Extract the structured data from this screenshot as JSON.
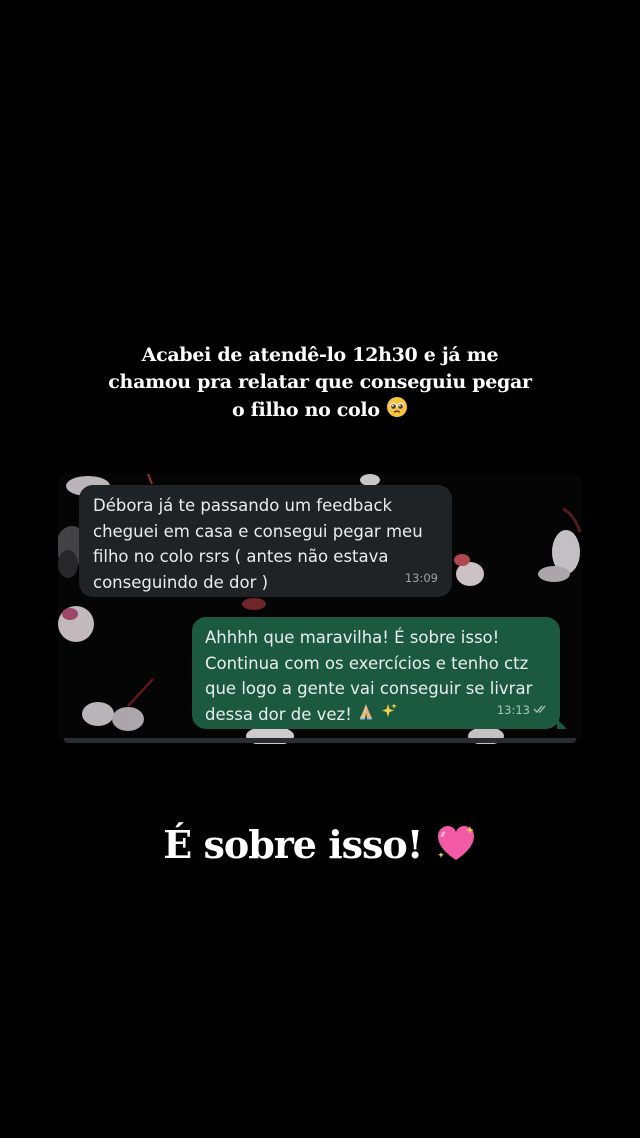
{
  "top_caption": {
    "line1": "Acabei de atendê-lo 12h30 e já me",
    "line2": "chamou pra relatar que conseguiu pegar",
    "line3": "o filho no colo",
    "emoji": "pleading-face-icon"
  },
  "chat": {
    "incoming": {
      "lines": [
        "Débora já te passando um feedback",
        "cheguei em casa e consegui pegar meu",
        "filho no colo rsrs ( antes não estava",
        "conseguindo de dor )"
      ],
      "time": "13:09"
    },
    "outgoing": {
      "lines": [
        "Ahhhh que maravilha! É sobre isso!",
        "Continua com os exercícios e tenho ctz",
        "que logo a gente vai conseguir se livrar",
        "dessa dor de vez!"
      ],
      "emojis": [
        "folded-hands-icon",
        "sparkles-icon"
      ],
      "time": "13:13",
      "status_icon": "double-check-icon"
    },
    "colors": {
      "incoming_bubble": "#1f2326",
      "outgoing_bubble": "#1b5a40",
      "background": "#050505"
    }
  },
  "bottom_caption": {
    "text": "É sobre isso!",
    "emoji": "sparkling-heart-icon"
  }
}
